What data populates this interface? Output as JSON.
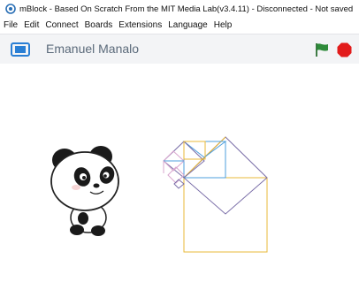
{
  "window": {
    "title": "mBlock - Based On Scratch From the MIT Media Lab(v3.4.11) - Disconnected - Not saved",
    "app_icon": "mblock-gear-icon"
  },
  "menu": {
    "items": [
      "File",
      "Edit",
      "Connect",
      "Boards",
      "Extensions",
      "Language",
      "Help"
    ]
  },
  "stage_header": {
    "sprite_name": "Emanuel Manalo",
    "mode_icon": "stage-mode-icon",
    "flag_icon": "green-flag-icon",
    "stop_icon": "stop-icon",
    "colors": {
      "flag": "#2e8b3a",
      "stop": "#e21b1b",
      "mode": "#2a7fd4"
    }
  },
  "stage": {
    "sprite": "panda-sprite",
    "drawing_colors": [
      "#e8b838",
      "#7a6ea8",
      "#4d9fdc",
      "#d9a7cf"
    ]
  }
}
